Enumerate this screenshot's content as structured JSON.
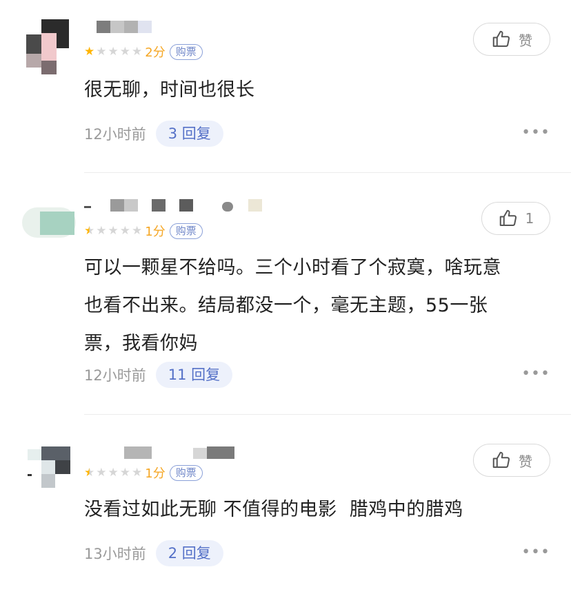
{
  "comments": [
    {
      "score": "2分",
      "tag": "购票",
      "like_label": "赞",
      "text": "很无聊，时间也很长",
      "time": "12小时前",
      "replies": "3 回复",
      "rating": 1
    },
    {
      "score": "1分",
      "tag": "购票",
      "like_label": "1",
      "text_lines": [
        "可以一颗星不给吗。三个小时看了个寂寞，啥玩意",
        "也看不出来。结局都没一个，毫无主题，55一张",
        "票，我看你妈"
      ],
      "time": "12小时前",
      "replies": "11 回复",
      "rating": 0.5
    },
    {
      "score": "1分",
      "tag": "购票",
      "like_label": "赞",
      "text": "没看过如此无聊 不值得的电影  腊鸡中的腊鸡",
      "time": "13小时前",
      "replies": "2 回复",
      "rating": 0.5
    }
  ],
  "icons": {
    "like": "thumbs-up-icon",
    "more": "more-dots-icon",
    "star": "star-icon"
  },
  "colors": {
    "star": "#ffb400",
    "score": "#f5a623",
    "reply_bg": "#edf1fb",
    "reply_text": "#5470c7"
  }
}
